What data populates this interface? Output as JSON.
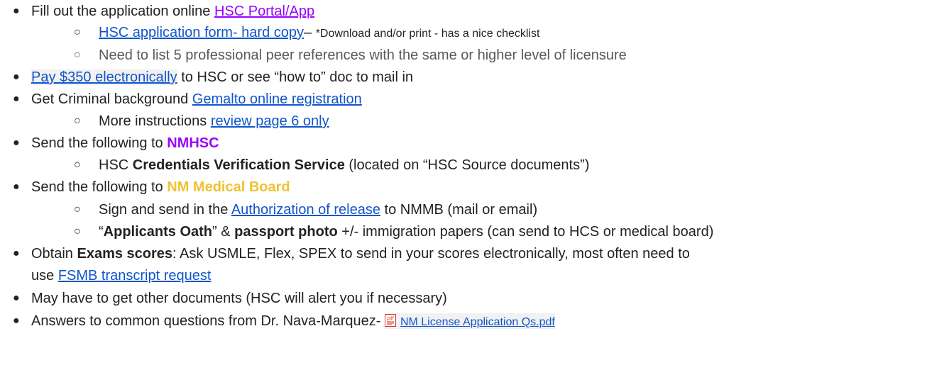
{
  "items": {
    "i1": {
      "text": "Fill out the application online ",
      "link": "HSC Portal/App"
    },
    "i2": {
      "link": "HSC application form- hard copy",
      "dash": "– ",
      "note": "*Download and/or print - has a nice checklist"
    },
    "i3": {
      "text": "Need to list 5 professional peer references with the same or higher level of licensure"
    },
    "i4": {
      "link": "Pay $350 electronically",
      "text": " to HSC or see “how to” doc to mail in"
    },
    "i5": {
      "text": "Get Criminal background ",
      "link": "Gemalto online registration"
    },
    "i6": {
      "text": "More instructions ",
      "link": "review page 6 only"
    },
    "i7": {
      "text": "Send the following to ",
      "bold": "NMHSC"
    },
    "i8": {
      "pre": "HSC ",
      "bold": "Credentials Verification Service",
      "post": " (located on “HSC Source documents”)"
    },
    "i9": {
      "text": "Send the following to ",
      "bold": "NM Medical Board"
    },
    "i10": {
      "pre": "Sign and send in the ",
      "link": "Authorization of release",
      "post": " to NMMB (mail or email)"
    },
    "i11": {
      "q1": "“",
      "bold1": "Applicants Oath",
      "mid": "” & ",
      "bold2": "passport photo",
      "post": " +/- immigration papers (can send to HCS or medical board)"
    },
    "i12": {
      "pre": "Obtain ",
      "bold": "Exams scores",
      "post": ": Ask USMLE, Flex, SPEX to send in your scores electronically, most often need to"
    },
    "i12b": {
      "pre": "use ",
      "link": "FSMB transcript request"
    },
    "i13": {
      "text": "May have to get other documents (HSC will alert you if necessary)"
    },
    "i14": {
      "text": "Answers to common questions from Dr. Nava-Marquez- ",
      "file": "NM License Application Qs.pdf",
      "icon": "pdf-icon"
    }
  },
  "bullets": {
    "level1": "●",
    "level2": "○"
  },
  "colors": {
    "link": "#1155cc",
    "purple": "#9900ff",
    "gold": "#f1c232",
    "pdf_red": "#d93025"
  }
}
